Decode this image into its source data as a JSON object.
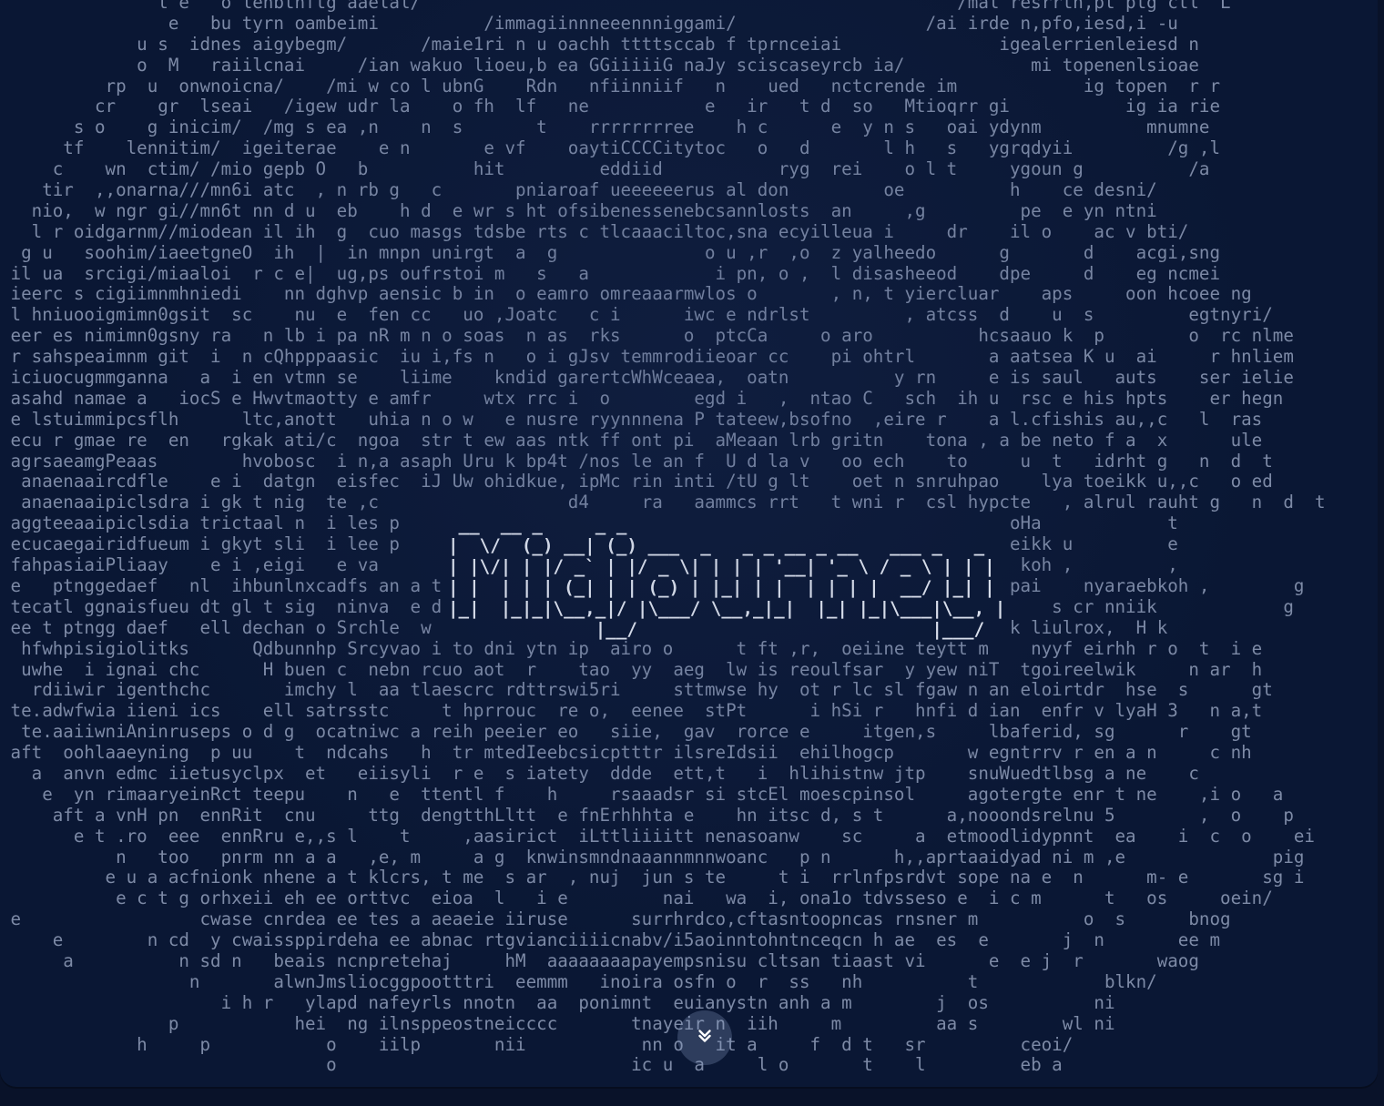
{
  "brand": {
    "logo_text": "Midjourney",
    "logo_art": [
      " __  __ _     _ _                                 ",
      "|  \\/  (_) __| (_) ___  _   _ _ __ _ __   ___ _   _ ",
      "| |\\/| | |/ _` | |/ _ \\| | | | '__| '_ \\ / _ \\ | | |",
      "| |  | | | (_| | | (_) | |_| | |  | | | |  __/ |_| |",
      "|_|  |_|_|\\__,_|/ |\\___/ \\__,_|_|  |_| |_|\\___|\\__, |",
      "              |__/                            |___/ "
    ]
  },
  "ascii_rows": [
    "               t e   o lenbtnftg aaelal/                                                   /mal resrrtn,pt ptg ctl  L",
    "                e   bu tyrn oambeimi          /immagiinnneeennniggami/                  /ai irde n,pfo,iesd,i -u",
    "             u s  idnes aigybegm/       /maie1ri n u oachh ttttsccab f tprnceiai               igealerrienleiesd n",
    "             o  M   raiilcnai     /ian wakuo lioeu,b ea GGiiiiiG naJy sciscaseyrcb ia/            mi topenenlsioae",
    "          rp  u  onwnoicna/    /mi w co l ubnG    Rdn   nfiinniif   n    ued   nctcrende im            ig topen  r r",
    "         cr    gr  lseai   /igew udr la    o fh  lf   ne           e   ir   t d  so   Mtioqrr gi           ig ia rie",
    "       s o    g inicim/  /mg s ea ,n    n  s       t    rrrrrrrree    h c      e  y n s   oai ydynm          mnumne",
    "      tf    lennitim/  igeiterae    e n       e vf    oaytiCCCCitytoc   o   d       l h   s   ygrqdyii         /g ,l",
    "     c    wn  ctim/ /mio gepb O   b          hit         eddiid           ryg  rei    o l t     ygoun g          /a",
    "    tir  ,,onarna///mn6i atc  , n rb g   c       pniaroaf ueeeeeerus al don         oe          h    ce desni/",
    "   nio,  w ngr gi//mn6t nn d u  eb    h d  e wr s ht ofsibenessenebcsannlosts  an     ,g         pe  e yn ntni",
    "   l r oidgarnm//miodean il ih  g  cuo masgs tdsbe rts c tlcaaaciltoc,sna ecyilleua i     dr    il o    ac v bti/",
    "  g u   soohim/iaeetgneO  ih  |  in mnpn unirgt  a  g              o u ,r  ,o  z yalheedo      g       d    acgi,sng",
    " il ua  srcigi/miaaloi  r c e|  ug,ps oufrstoi m   s   a            i pn, o ,  l disasheeod    dpe     d    eg ncmei",
    " ieerc s cigiimnmhniedi    nn dghvp aensic b in  o eamro omreaaarmwlos o       , n, t yiercluar    aps     oon hcoee ng",
    " l hniuooigmimn0gsit  sc    nu  e  fen cc   uo ,Joatc   c i      iwc e ndrlst         , atcss  d    u  s         egtnyri/",
    " eer es nimimn0gsny ra   n lb i pa nR m n o soas  n as  rks      o  ptcCa     o aro          hcsaauo k  p        o  rc nlme",
    " r sahspeaimnm git  i  n cQhpppaasic  iu i,fs n   o i gJsv temmrodiieoar cc    pi ohtrl       a aatsea K u  ai     r hnliem",
    " iciuocugmmganna   a  i en vtmn se    liime    kndid garertcWhWceaea,  oatn          y rn     e is saul   auts    ser ielie",
    " asahd namae a   iocS e Hwvtmaotty e amfr     wtx rrc i  o        egd i   ,  ntao C   sch  ih u  rsc e his hpts    er hegn",
    " e lstuimmipcsflh      ltc,anott   uhia n o w   e nusre ryynnnena P tateew,bsofno  ,eire r    a l.cfishis au,,c   l  ras",
    " ecu r gmae re  en   rgkak ati/c  ngoa  str t ew aas ntk ff ont pi  aMeaan lrb gritn    tona , a be neto f a  x      ule",
    " agrsaeamgPeaas        hvobosc  i n,a asaph Uru k bp4t /nos le an f  U d la v   oo ech    to     u  t   idrht g   n  d  t",
    "  anaenaaircdfle    e i  datgn  eisfec  iJ Uw ohidkue, ipMc rin inti /tU g lt    oet n snruhpao    lya toeikk u,,c   o ed",
    "  anaenaaipiclsdra i gk t nig  te ,c                  d4     ra   aammcs rrt   t wni r  csl hypcte   , alrul rauht g   n  d  t",
    " aggteeaaipiclsdia trictaal n  i les p                                    ,n iigb n     s civxh oHa            t",
    " ecucaegairidfueum i gkyt sli  i lee p                                    iia    tea,io   nyara eikk u         e",
    " fahpasiaiPliaay    e i ,eigi   e va                                      lia    tfad eT  i y ae koh ,         ,",
    " e   ptnggedaef   nl  ihbunlnxcadfs an a trwiup is        nam  b pmum n, ,sctut        t g iif hpai    nyaraebkoh ,        g",
    " tecatl ggnaisfueu dt gl t sig  ninva  e dd t np b i,a r lacvu sae;von/ ce t rnoa aht  hplceh m     s cr nniik            g",
    " ee t ptngg daef   ell dechan o Srchle  w e riw uhci ,ao  h npnsc2,f s  b i end h efnr s tfnrsn k liulrox,  H k",
    "  hfwhpisigiolitks      Qdbunnhp Srcyvao i to dni ytn ip  airo o      t ft ,r,  oeiine teytt m    nyyf eirhh r o  t  i e",
    "  uwhe  i ignai chc      H buen c  nebn rcuo aot  r    tao  yy  aeg  lw is reoulfsar  y yew niT  tgoireelwik     n ar  h",
    "   rdiiwir igenthchc       imchy l  aa tlaescrc rdttrswi5ri     sttmwse hy  ot r lc sl fgaw n an eloirtdr  hse  s      gt",
    " te.adwfwia iieni ics    ell satrsstc     t hprrouc  re o,  eenee  stPt      i hSi r   hnfi d ian  enfr v lyaH 3   n a,t",
    "  te.aaiiwniAninruseps o d g  ocatniwc a reih peeier eo   siie,  gav  rorce e     itgen,s     lbaferid, sg      r    gt",
    " aft  oohlaaeyning  p uu    t  ndcahs   h  tr mtedIeebcsicptttr ilsreIdsii  ehilhogcp       w egntrrv r en a n     c nh",
    "   a  anvn edmc iietusyclpx  et   eiisyli  r e  s iatety  ddde  ett,t   i  hlihistnw jtp    snuWuedtlbsg a ne    c",
    "    e  yn rimaaryeinRct teepu    n   e  ttentl f    h     rsaaadsr si stcEl moescpinsol     agotergte enr t ne    ,i o   a",
    "     aft a vnH pn  ennRit  cnu     ttg  dengtthLltt  e fnErhhhta e    hn itsc d, s t      a,nooondsrelnu 5        ,  o    p",
    "       e t .ro  eee  ennRru e,,s l    t     ,aasirict  iLttliiiitt nenasoanw    sc     a  etmoodlidypnnt  ea    i  c  o    ei",
    "           n   too   pnrm nn a a   ,e, m     a g  knwinsmndnaaannmnnwoanc   p n      h,,aprtaaidyad ni m ,e              pig",
    "          e u a acfnionk nhene a t klcrs, t me  s ar  , nuj  jun s te     t i  rrlnfpsrdvt sope na e  n      m- e       sg i",
    "           e c t g orhxeii eh ee orttvc  eioa  l   i e         nai   wa  i, ona1o tdvsseso e  i c m      t   os     oein/",
    " e                 cwase cnrdea ee tes a aeaeie iiruse      surrhrdco,cftasntoopncas rnsner m          o  s      bnog",
    "     e        n cd  y cwaissppirdeha ee abnac rtgvianciiiicnabv/i5aoinntohntnceqcn h ae  es  e       j  n       ee m",
    "      a          n sd n   beais ncnpretehaj     hM  aaaaaaaapayempsnisu cltsan tiaast vi      e  e j  r       waog",
    "                  n       alwnJmsliocggpootttri  eemmm   inoira osfn o  r  ss   nh          t            blkn/",
    "                     i h r   ylapd nafeyrls nnotn  aa  ponimnt  euianystn anh a m        j  os          ni",
    "                p           hei  ng ilnsppeostneicccc       tnayeir n  iih     m         aa s        wl ni",
    "             h     p           o    iilp       nii           nn o   it a     f  d t   sr         ceoi/",
    "                               o                            ic u  a     l o       t    l         eb a"
  ],
  "scroll": {
    "icon": "double-chevron-down-icon",
    "color": "#ffffff"
  },
  "colors": {
    "background": "#0a1734",
    "outer": "#091229",
    "ascii": "#7d8aa6",
    "logo": "#e6ebf5"
  }
}
